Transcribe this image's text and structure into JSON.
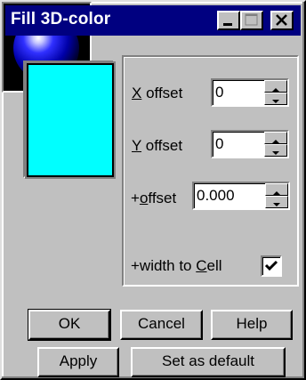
{
  "window": {
    "title": "Fill 3D-color"
  },
  "preview": {
    "color_hex": "#00ffff"
  },
  "fields": {
    "x_offset": {
      "label_key": "X",
      "label_rest": " offset",
      "value": "0"
    },
    "y_offset": {
      "label_key": "Y",
      "label_rest": " offset",
      "value": "0"
    },
    "plus_offset": {
      "label_pre": "+",
      "label_key": "o",
      "label_rest": "ffset",
      "value": "0.000"
    },
    "width_to_cell": {
      "label_pre": "+width to ",
      "label_key": "C",
      "label_rest": "ell",
      "checked": true
    }
  },
  "buttons": {
    "ok": "OK",
    "cancel": "Cancel",
    "help": "Help",
    "apply": "Apply",
    "set_default": "Set as default"
  },
  "icons": {
    "minimize": "minimize-icon",
    "maximize": "maximize-icon",
    "close": "close-icon",
    "spin_up": "arrow-up-icon",
    "spin_down": "arrow-down-icon",
    "check": "checkmark-icon"
  }
}
